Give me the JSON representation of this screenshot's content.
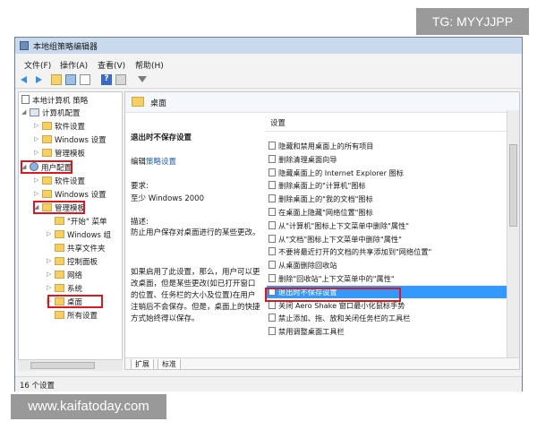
{
  "watermarks": {
    "top": "TG: MYYJJPP",
    "bottom": "www.kaifatoday.com"
  },
  "window": {
    "title": "本地组策略编辑器"
  },
  "menu": [
    "文件(F)",
    "操作(A)",
    "查看(V)",
    "帮助(H)"
  ],
  "icons": {
    "back": "back-arrow-icon",
    "forward": "forward-arrow-icon",
    "help": "?"
  },
  "tree": {
    "root": "本地计算机 策略",
    "computer_config": "计算机配置",
    "software_settings": "软件设置",
    "windows_settings": "Windows 设置",
    "admin_templates": "管理模板",
    "user_config": "用户配置",
    "user_software": "软件设置",
    "user_windows": "Windows 设置",
    "user_admin": "管理模板",
    "start_menu": "\"开始\" 菜单",
    "windows_components": "Windows 组",
    "shared_folders": "共享文件夹",
    "control_panel": "控制面板",
    "network": "网络",
    "system": "系统",
    "desktop": "桌面",
    "all_settings": "所有设置"
  },
  "detail": {
    "header": "桌面",
    "setting_title": "退出时不保存设置",
    "edit_prefix": "编辑",
    "edit_link": "策略设置",
    "requirements_label": "要求:",
    "requirements_value": "至少 Windows 2000",
    "description_label": "描述:",
    "description_text": "防止用户保存对桌面进行的某些更改。",
    "more_text": "如果启用了此设置，那么，用户可以更改桌面，但是某些更改(如已打开窗口的位置、任务栏的大小及位置)在用户注销后不会保存。但是，桌面上的快捷方式始终得以保存。",
    "column_header": "设置",
    "settings": [
      "隐藏和禁用桌面上的所有项目",
      "删除清理桌面向导",
      "隐藏桌面上的 Internet Explorer 图标",
      "删除桌面上的\"计算机\"图标",
      "删除桌面上的\"我的文档\"图标",
      "在桌面上隐藏\"网络位置\"图标",
      "从\"计算机\"图标上下文菜单中删除\"属性\"",
      "从\"文档\"图标上下文菜单中删除\"属性\"",
      "不要将最近打开的文档的共享添加到\"网络位置\"",
      "从桌面删除回收站",
      "删除\"回收站\"上下文菜单中的\"属性\"",
      "退出时不保存设置",
      "关闭 Aero Shake 窗口最小化鼠标手势",
      "禁止添加、拖、放和关闭任务栏的工具栏",
      "禁用调整桌面工具栏"
    ],
    "selected_index": 11
  },
  "tabs": [
    "扩展",
    "标准"
  ],
  "status": {
    "text": "16 个设置"
  }
}
